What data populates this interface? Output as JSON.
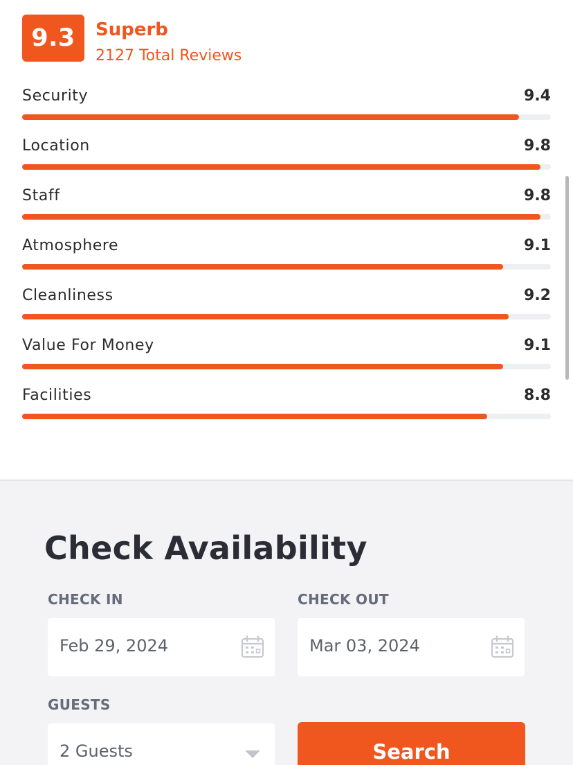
{
  "colors": {
    "accent": "#f0571f",
    "track": "#eeeff2",
    "section_bg": "#f3f3f5",
    "title_text": "#2a2d35",
    "label_text": "#656b7a"
  },
  "rating": {
    "score": "9.3",
    "word": "Superb",
    "reviews_text": "2127 Total Reviews"
  },
  "categories": [
    {
      "name": "Security",
      "score": "9.4",
      "value": 9.4
    },
    {
      "name": "Location",
      "score": "9.8",
      "value": 9.8
    },
    {
      "name": "Staff",
      "score": "9.8",
      "value": 9.8
    },
    {
      "name": "Atmosphere",
      "score": "9.1",
      "value": 9.1
    },
    {
      "name": "Cleanliness",
      "score": "9.2",
      "value": 9.2
    },
    {
      "name": "Value For Money",
      "score": "9.1",
      "value": 9.1
    },
    {
      "name": "Facilities",
      "score": "8.8",
      "value": 8.8
    }
  ],
  "rating_scale_max": 10,
  "availability": {
    "title": "Check Availability",
    "check_in_label": "CHECK IN",
    "check_in_value": "Feb 29, 2024",
    "check_out_label": "CHECK OUT",
    "check_out_value": "Mar 03, 2024",
    "guests_label": "GUESTS",
    "guests_value": "2 Guests",
    "search_label": "Search"
  },
  "icons": {
    "check_in": "calendar-icon",
    "check_out": "calendar-icon",
    "guests": "chevron-down-icon"
  }
}
